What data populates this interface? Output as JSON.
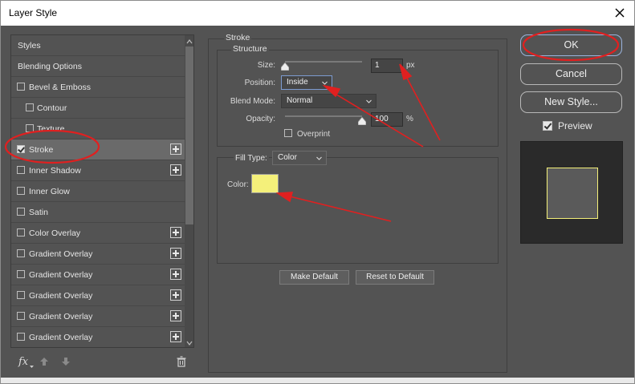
{
  "window": {
    "title": "Layer Style"
  },
  "styles_list": {
    "items": [
      {
        "label": "Styles",
        "checkbox": false,
        "checked": false,
        "plus": false,
        "selected": false
      },
      {
        "label": "Blending Options",
        "checkbox": false,
        "checked": false,
        "plus": false,
        "selected": false
      },
      {
        "label": "Bevel & Emboss",
        "checkbox": true,
        "checked": false,
        "plus": false,
        "selected": false
      },
      {
        "label": "Contour",
        "checkbox": true,
        "checked": false,
        "plus": false,
        "selected": false,
        "indent": true
      },
      {
        "label": "Texture",
        "checkbox": true,
        "checked": false,
        "plus": false,
        "selected": false,
        "indent": true
      },
      {
        "label": "Stroke",
        "checkbox": true,
        "checked": true,
        "plus": true,
        "selected": true
      },
      {
        "label": "Inner Shadow",
        "checkbox": true,
        "checked": false,
        "plus": true,
        "selected": false
      },
      {
        "label": "Inner Glow",
        "checkbox": true,
        "checked": false,
        "plus": false,
        "selected": false
      },
      {
        "label": "Satin",
        "checkbox": true,
        "checked": false,
        "plus": false,
        "selected": false
      },
      {
        "label": "Color Overlay",
        "checkbox": true,
        "checked": false,
        "plus": true,
        "selected": false
      },
      {
        "label": "Gradient Overlay",
        "checkbox": true,
        "checked": false,
        "plus": true,
        "selected": false
      },
      {
        "label": "Gradient Overlay",
        "checkbox": true,
        "checked": false,
        "plus": true,
        "selected": false
      },
      {
        "label": "Gradient Overlay",
        "checkbox": true,
        "checked": false,
        "plus": true,
        "selected": false
      },
      {
        "label": "Gradient Overlay",
        "checkbox": true,
        "checked": false,
        "plus": true,
        "selected": false
      },
      {
        "label": "Gradient Overlay",
        "checkbox": true,
        "checked": false,
        "plus": true,
        "selected": false
      }
    ],
    "footer": {
      "fx_label": "fx"
    }
  },
  "stroke": {
    "section_title": "Stroke",
    "structure_title": "Structure",
    "size_label": "Size:",
    "size_value": "1",
    "size_unit": "px",
    "position_label": "Position:",
    "position_value": "Inside",
    "blend_mode_label": "Blend Mode:",
    "blend_mode_value": "Normal",
    "opacity_label": "Opacity:",
    "opacity_value": "100",
    "opacity_unit": "%",
    "overprint_label": "Overprint",
    "overprint_checked": false,
    "fill_type_label": "Fill Type:",
    "fill_type_value": "Color",
    "color_label": "Color:",
    "color_hex": "#f4f07a",
    "make_default_label": "Make Default",
    "reset_default_label": "Reset to Default"
  },
  "actions": {
    "ok_label": "OK",
    "cancel_label": "Cancel",
    "new_style_label": "New Style...",
    "preview_label": "Preview",
    "preview_checked": true
  },
  "theme": {
    "panel_bg": "#535353",
    "annotation_red": "#e02020"
  }
}
